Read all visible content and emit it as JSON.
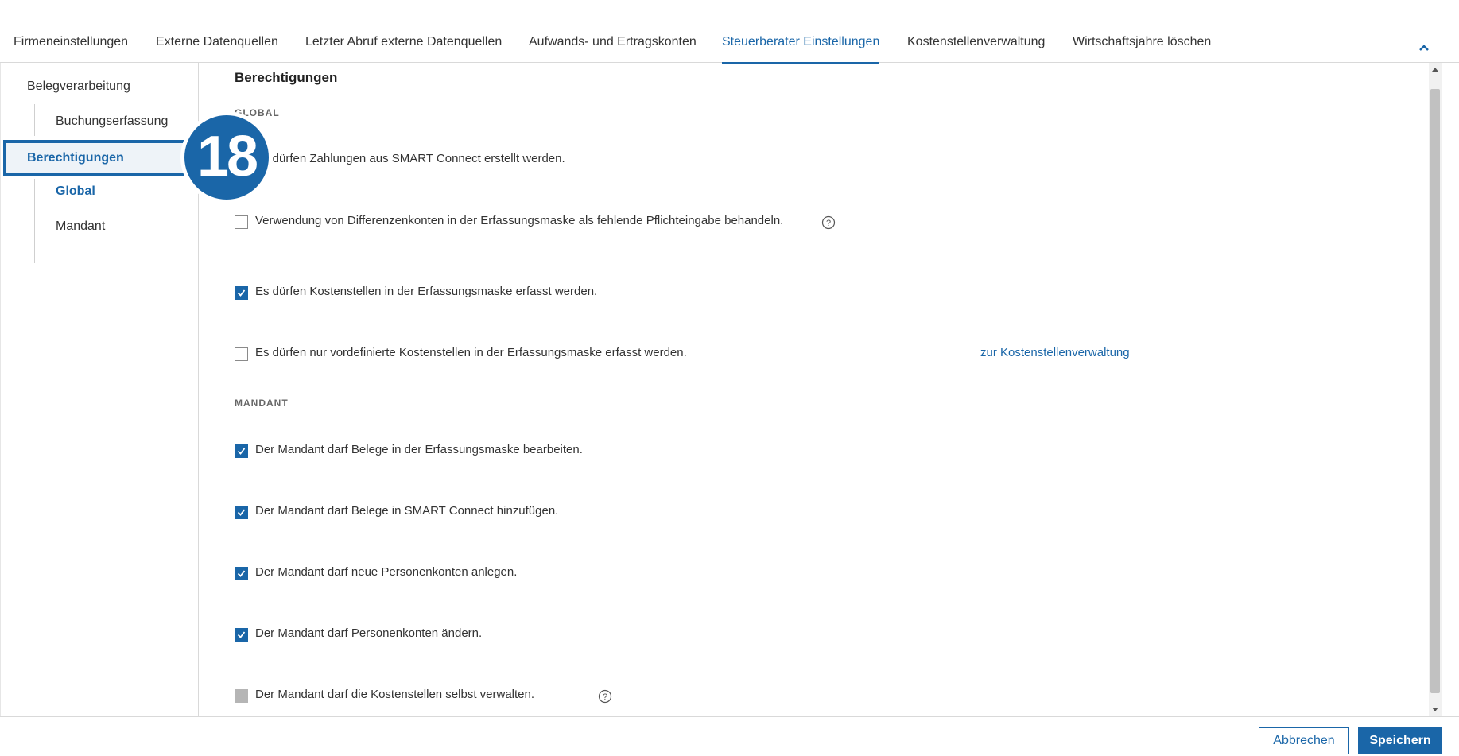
{
  "tabs": [
    {
      "label": "Firmeneinstellungen"
    },
    {
      "label": "Externe Datenquellen"
    },
    {
      "label": "Letzter Abruf externe Datenquellen"
    },
    {
      "label": "Aufwands- und Ertragskonten"
    },
    {
      "label": "Steuerberater Einstellungen",
      "active": true
    },
    {
      "label": "Kostenstellenverwaltung"
    },
    {
      "label": "Wirtschaftsjahre löschen"
    }
  ],
  "sidebar": {
    "items": [
      {
        "label": "Belegverarbeitung"
      },
      {
        "label": "Buchungserfassung"
      },
      {
        "label": "Berechtigungen",
        "active": true
      },
      {
        "label": "Global",
        "active": true
      },
      {
        "label": "Mandant"
      }
    ]
  },
  "step_badge": "18",
  "content": {
    "title": "Berechtigungen",
    "global_label": "GLOBAL",
    "global_options": [
      {
        "label": "Es dürfen Zahlungen aus SMART Connect erstellt werden.",
        "checked": true
      },
      {
        "label": "Verwendung von Differenzenkonten in der Erfassungsmaske als fehlende Pflichteingabe behandeln.",
        "checked": false,
        "help": true
      },
      {
        "label": "Es dürfen Kostenstellen in der Erfassungsmaske erfasst werden.",
        "checked": true
      },
      {
        "label": "Es dürfen nur vordefinierte Kostenstellen in der Erfassungsmaske erfasst werden.",
        "checked": false,
        "link": "zur Kostenstellenverwaltung"
      }
    ],
    "mandant_label": "MANDANT",
    "mandant_options": [
      {
        "label": "Der Mandant darf Belege in der Erfassungsmaske bearbeiten.",
        "checked": true
      },
      {
        "label": "Der Mandant darf Belege in SMART Connect hinzufügen.",
        "checked": true
      },
      {
        "label": "Der Mandant darf neue Personenkonten anlegen.",
        "checked": true
      },
      {
        "label": "Der Mandant darf Personenkonten ändern.",
        "checked": true
      },
      {
        "label": "Der Mandant darf die Kostenstellen selbst verwalten.",
        "checked": false,
        "disabled": true,
        "help": true
      }
    ]
  },
  "footer": {
    "cancel_label": "Abbrechen",
    "save_label": "Speichern"
  },
  "colors": {
    "accent": "#1a66a8",
    "disabled": "#b5b5b5"
  }
}
